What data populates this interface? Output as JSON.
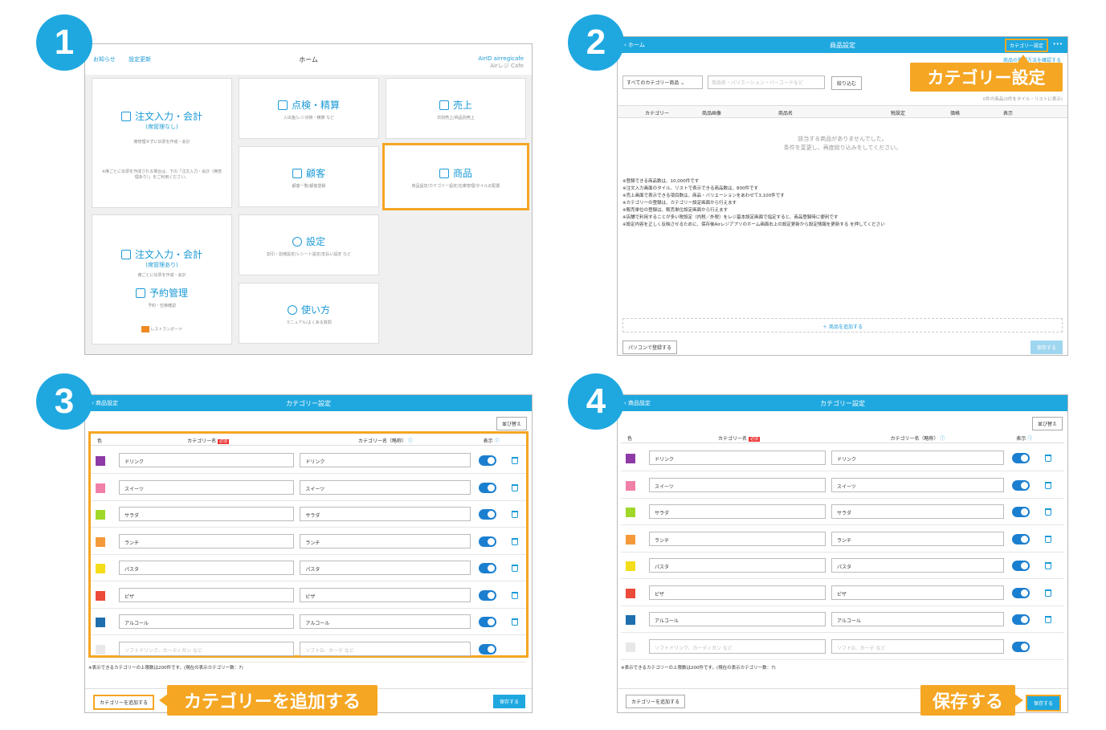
{
  "steps": [
    "1",
    "2",
    "3",
    "4"
  ],
  "home": {
    "links": [
      "お知らせ",
      "設定更新"
    ],
    "title": "ホーム",
    "account": "AirID airregicafe",
    "store": "Airレジ Cafe",
    "tiles": [
      {
        "title": "注文入力・会計",
        "note": "(席管理なし)",
        "sub": "席管理せずに伝票を作成・会計",
        "sub2": "※席ごとに伝票を作成される場合は、下の「注文入力・会計（席管理あり）」をご利用ください。"
      },
      {
        "title": "点検・精算",
        "sub": "入出金/レジ点検・精算 など"
      },
      {
        "title": "売上",
        "sub": "日別売上/商品別売上"
      },
      {
        "title": "顧客",
        "sub": "顧客一覧/顧客登録"
      },
      {
        "title": "商品",
        "sub": "商品設定/カテゴリー設定/在庫管理/タイルの配置"
      },
      {
        "title": "注文入力・会計",
        "note": "(席管理あり)",
        "sub": "席ごとに伝票を作成・会計"
      },
      {
        "title": "予約管理",
        "sub": "予約・空席確認"
      },
      {
        "title": "設定",
        "sub": "割引・割増設定/レシート設定/支払い設定 など"
      },
      {
        "title": "使い方",
        "sub": "マニュアル/よくある質問"
      }
    ],
    "restaurant_board": "レストランボード"
  },
  "products": {
    "back": "ホーム",
    "title": "商品設定",
    "category_button": "カテゴリー設定",
    "more": "•••",
    "helper_link": "商品の登録方法を確認する",
    "filter_select": "すべてのカテゴリー商品",
    "search_placeholder": "商品名・バリエーション・バーコードなど",
    "filter_button": "絞り込む",
    "count_text": "0件の商品(0件をタイル・リストに表示)",
    "columns": [
      "カテゴリー",
      "商品画像",
      "商品名",
      "税設定",
      "価格",
      "表示"
    ],
    "required": "必須",
    "empty1": "該当する商品がありませんでした。",
    "empty2": "条件を変更し、再度絞り込みをしてください。",
    "notes": [
      "※登録できる商品数は、10,000件です",
      "※注文入力画面のタイル、リストで表示できる商品数は、800件です",
      "※売上画面で表示できる項目数は、商品・バリエーションをあわせて3,100件です",
      "※カテゴリーの登録は、カテゴリー設定画面から行えます",
      "※販売単位の登録は、販売単位設定画面から行えます",
      "※店舗で利用することが多い税設定（内税／外税）をレジ基本設定画面で指定すると、商品登録時に便利です",
      "※設定内容を正しく反映させるために、保存後Airレジアプリのホーム画面右上の設定更新から設定情報を更新する を押してください"
    ],
    "add_product": "＋ 商品を追加する",
    "pc_button": "パソコンで登録する",
    "save": "保存する",
    "callout": "カテゴリー設定"
  },
  "category": {
    "back": "商品設定",
    "title": "カテゴリー設定",
    "sort": "並び替え",
    "cols": [
      "色",
      "カテゴリー名",
      "カテゴリー名（略称）",
      "表示"
    ],
    "required": "必須",
    "rows": [
      {
        "name": "ドリンク",
        "short": "ドリンク",
        "color": "#8e3aa7"
      },
      {
        "name": "スイーツ",
        "short": "スイーツ",
        "color": "#f080a8"
      },
      {
        "name": "サラダ",
        "short": "サラダ",
        "color": "#a0d82a"
      },
      {
        "name": "ランチ",
        "short": "ランチ",
        "color": "#f59a3a"
      },
      {
        "name": "パスタ",
        "short": "パスタ",
        "color": "#f4dd1a"
      },
      {
        "name": "ピザ",
        "short": "ピザ",
        "color": "#ec4a3a"
      },
      {
        "name": "アルコール",
        "short": "アルコール",
        "color": "#1e6fae"
      }
    ],
    "empty_row": {
      "name_ph": "ソフトドリンク、カーディガン など",
      "short_ph": "ソフトD、カーデ など",
      "color": "#e8e8e8"
    },
    "limit_note": "※表示できるカテゴリーの上限数は200件です。(現在の表示カテゴリー数：7)",
    "add": "カテゴリーを追加する",
    "save": "保存する",
    "callout_add": "カテゴリーを追加する",
    "callout_save": "保存する"
  }
}
